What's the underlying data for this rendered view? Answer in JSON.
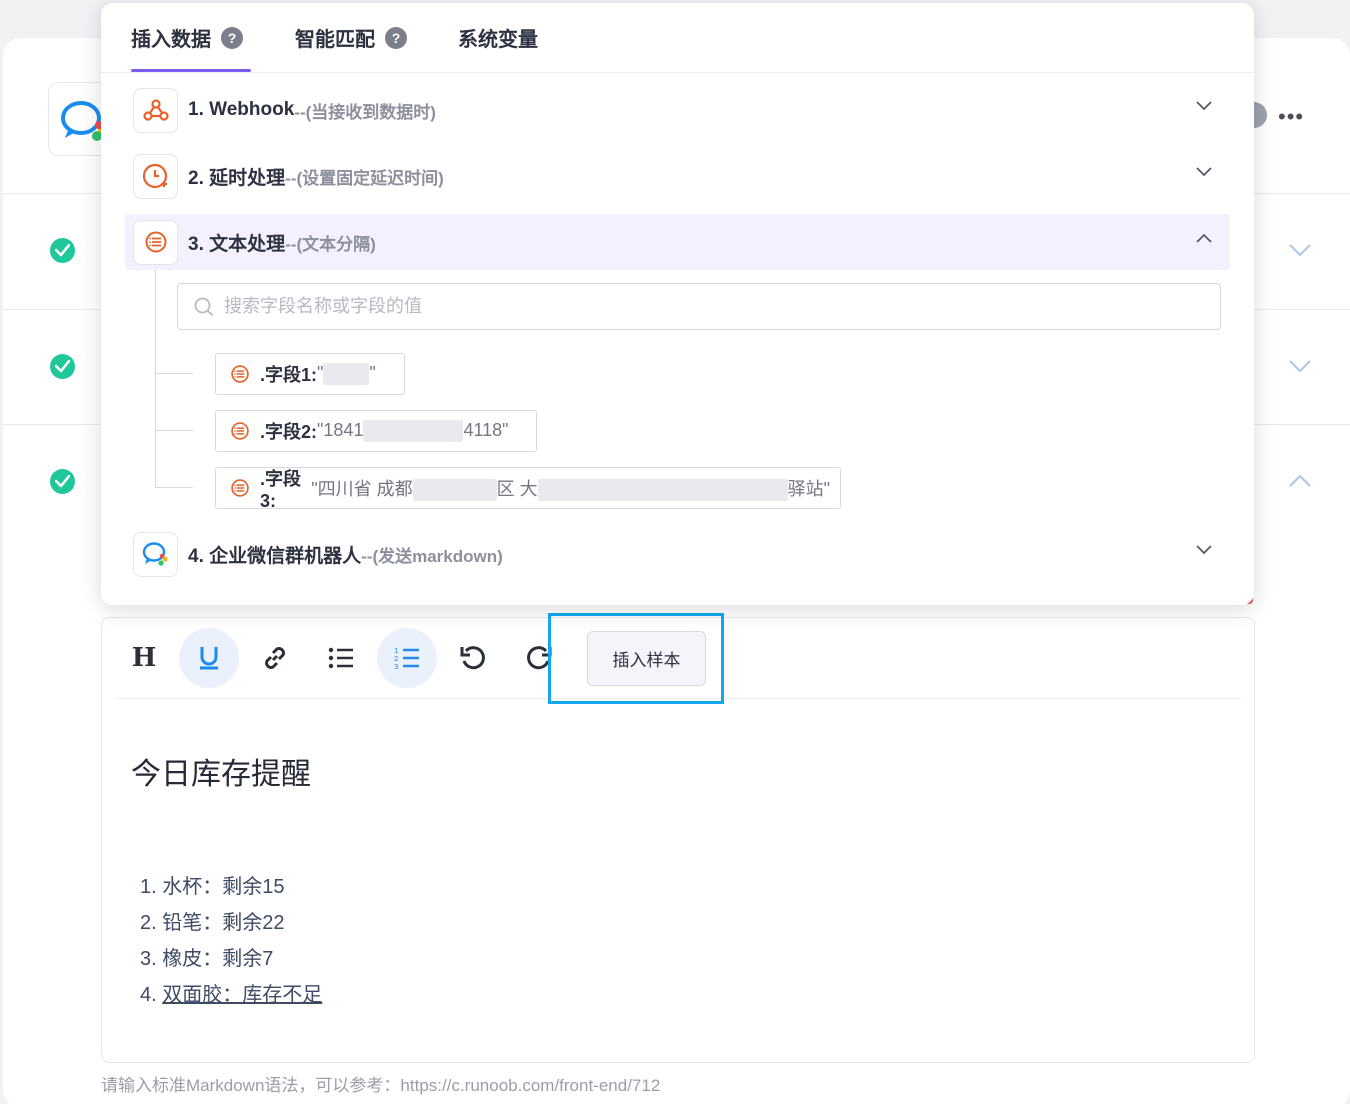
{
  "popover": {
    "tabs": [
      {
        "label": "插入数据",
        "help": "?"
      },
      {
        "label": "智能匹配",
        "help": "?"
      },
      {
        "label": "系统变量"
      }
    ],
    "steps": [
      {
        "title": "1. Webhook",
        "subtitle": "--(当接收到数据时)",
        "icon": "webhook-icon"
      },
      {
        "title": "2. 延时处理",
        "subtitle": "--(设置固定延迟时间)",
        "icon": "clock-icon"
      },
      {
        "title": "3. 文本处理",
        "subtitle": "--(文本分隔)",
        "icon": "text-split-icon"
      },
      {
        "title": "4. 企业微信群机器人",
        "subtitle": "--(发送markdown)",
        "icon": "wecom-icon"
      }
    ],
    "search_placeholder": "搜索字段名称或字段的值",
    "fields": [
      {
        "name": ".字段1:",
        "value_prefix": "\"",
        "value_suffix": "\""
      },
      {
        "name": ".字段2:",
        "value_prefix": "\"1841",
        "value_suffix": "4118\""
      },
      {
        "name": ".字段3:",
        "value_prefix": "\"四川省 成都",
        "value_middle": "区 大",
        "value_suffix": "驿站\""
      }
    ]
  },
  "editor": {
    "toolbar": {
      "heading": "H",
      "insert_sample_label": "插入样本"
    },
    "content": {
      "heading": "今日库存提醒",
      "items": [
        "1. 水杯：剩余15",
        "2. 铅笔：剩余22",
        "3. 橡皮：剩余7",
        "4. ",
        "双面胶：库存不足"
      ]
    },
    "hint": "请输入标准Markdown语法，可以参考：https://c.runoob.com/front-end/712"
  },
  "header": {
    "more": "•••"
  },
  "colors": {
    "accent": "#7a5cf0",
    "highlight": "#13a7f0",
    "success": "#1fc79a",
    "step_icon": "#e8622a"
  }
}
